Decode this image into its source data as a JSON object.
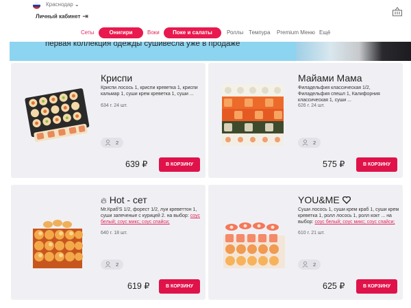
{
  "header": {
    "city": "Краснодар",
    "account_label": "Личный кабинет",
    "colors": {
      "accent": "#e8194e",
      "banner": "#8dd4f0",
      "card_bg": "#f0f0f4"
    }
  },
  "nav": {
    "items": [
      {
        "label": "Сеты",
        "style": "link"
      },
      {
        "label": "Онигири",
        "style": "pill"
      },
      {
        "label": "Воки",
        "style": "link"
      },
      {
        "label": "Поке и салаты",
        "style": "pill"
      },
      {
        "label": "Роллы",
        "style": "plain"
      },
      {
        "label": "Темпура",
        "style": "plain"
      },
      {
        "label": "Premium Меню",
        "style": "plain"
      },
      {
        "label": "Ещё",
        "style": "plain"
      }
    ]
  },
  "banner": {
    "text": "первая коллекция одежды сушивесла уже в продаже"
  },
  "products": [
    {
      "title": "Криспи",
      "desc": "Криспи лосось 1, криспи креветка 1, криспи кальмар 1, суши крем креветка 1, суши ...",
      "meta": "634 г. 24 шт.",
      "persons": "2",
      "price": "639 ₽",
      "button": "В КОРЗИНУ"
    },
    {
      "title": "Майами Мама",
      "desc": "Филадельфия классическая 1/2, Филадельфия спешл 1, Калифорния классическая 1, суши ...",
      "meta": "626 г. 24 шт.",
      "persons": "2",
      "price": "575 ₽",
      "button": "В КОРЗИНУ"
    },
    {
      "title": "Hot - сет",
      "title_icon": "fire-icon",
      "desc": "Mr.Краб'S 1/2, форест 1/2, луи креветтон 1, суши запеченые с курицей 2. на выбор:",
      "desc_links": "соус белый; соус микс; соус спайси;",
      "meta": "640 г. 18 шт.",
      "persons": "2",
      "price": "619 ₽",
      "button": "В КОРЗИНУ"
    },
    {
      "title": "YOU&ME",
      "title_icon": "heart-icon",
      "desc": "Суши лосось 1, суши крем краб 1, суши крем креветка 1, ролл лосось 1, ролл кокт ... на выбор:",
      "desc_links": "соус белый; соус микс; соус спайси;",
      "meta": "610 г. 21 шт.",
      "persons": "2",
      "price": "625 ₽",
      "button": "В КОРЗИНУ"
    }
  ]
}
